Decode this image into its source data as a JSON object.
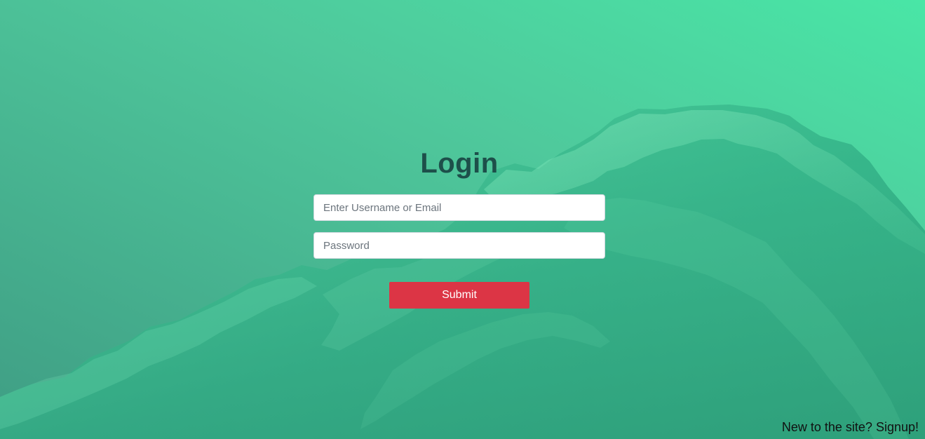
{
  "login": {
    "title": "Login",
    "username_placeholder": "Enter Username or Email",
    "password_placeholder": "Password",
    "submit_label": "Submit"
  },
  "footer": {
    "signup_text": "New to the site? Signup!"
  },
  "colors": {
    "background_top": "#49e6a6",
    "background_bottom": "#3f9d84",
    "title": "#1d4f4a",
    "submit": "#dc3545",
    "link": "#111111"
  }
}
